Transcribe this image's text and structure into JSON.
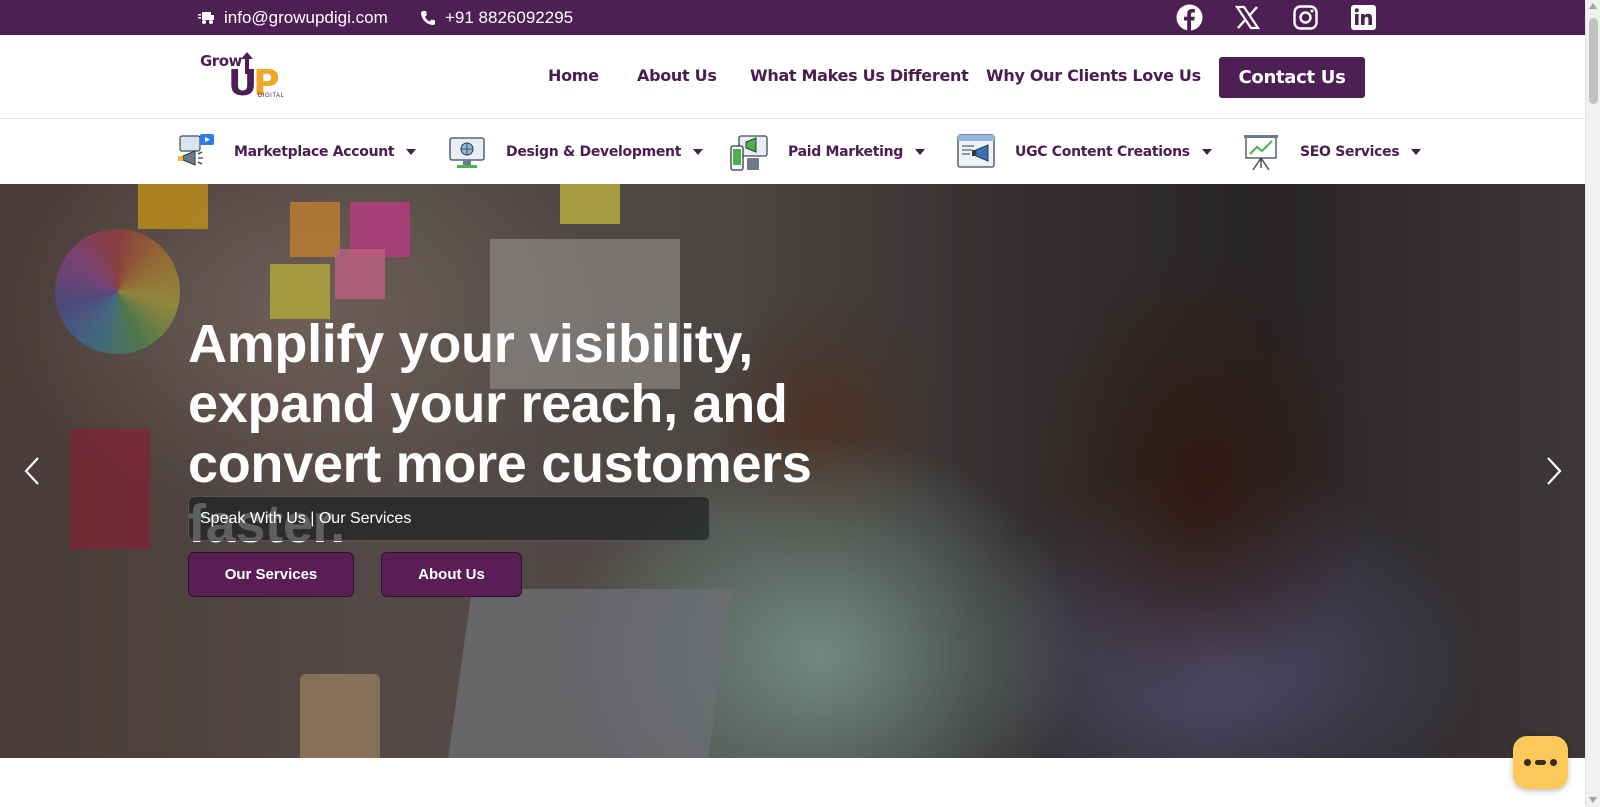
{
  "topbar": {
    "email": "info@growupdigi.com",
    "phone": "+91 8826092295",
    "email_icon": "mail-truck-icon",
    "phone_icon": "phone-icon",
    "socials": [
      "facebook-icon",
      "x-icon",
      "instagram-icon",
      "linkedin-icon"
    ],
    "color": "#4e1f54"
  },
  "logo": {
    "grow": "Grow",
    "up_u": "U",
    "up_p": "P",
    "digital": "DIGITAL",
    "accent": "#f0a723"
  },
  "nav": {
    "items": [
      "Home",
      "About Us",
      "What Makes Us Different",
      "Why Our Clients Love Us"
    ],
    "cta": "Contact Us"
  },
  "services_menu": {
    "items": [
      {
        "label": "Marketplace Account",
        "icon": "megaphone-video-icon"
      },
      {
        "label": "Design & Development",
        "icon": "monitor-globe-icon"
      },
      {
        "label": "Paid Marketing",
        "icon": "devices-megaphone-icon"
      },
      {
        "label": "UGC Content Creations",
        "icon": "browser-megaphone-icon"
      },
      {
        "label": "SEO Services",
        "icon": "presentation-chart-icon"
      }
    ]
  },
  "hero": {
    "headline": "Amplify your visibility, expand your reach, and convert more customers faster.",
    "tagline": "Speak With Us | Our Services",
    "buttons": [
      "Our Services",
      "About Us"
    ],
    "prev_icon": "chevron-left-icon",
    "next_icon": "chevron-right-icon"
  },
  "chat": {
    "icon": "chat-bubble-icon",
    "color": "#fdc85a"
  }
}
